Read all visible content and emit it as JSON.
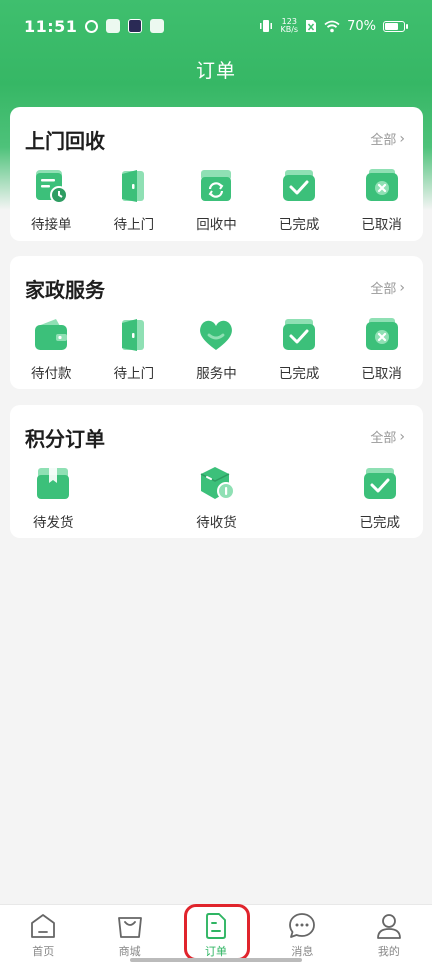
{
  "status_bar": {
    "time": "11:51",
    "net_speed_top": "123",
    "net_speed_bottom": "KB/s",
    "battery": "70%"
  },
  "header": {
    "title": "订单"
  },
  "sections": [
    {
      "title": "上门回收",
      "all_label": "全部",
      "items": [
        {
          "label": "待接单",
          "icon": "pending-order-icon"
        },
        {
          "label": "待上门",
          "icon": "door-icon"
        },
        {
          "label": "回收中",
          "icon": "recycle-box-icon"
        },
        {
          "label": "已完成",
          "icon": "check-icon"
        },
        {
          "label": "已取消",
          "icon": "cancel-icon"
        }
      ]
    },
    {
      "title": "家政服务",
      "all_label": "全部",
      "items": [
        {
          "label": "待付款",
          "icon": "wallet-icon"
        },
        {
          "label": "待上门",
          "icon": "door-icon"
        },
        {
          "label": "服务中",
          "icon": "heart-icon"
        },
        {
          "label": "已完成",
          "icon": "check-icon"
        },
        {
          "label": "已取消",
          "icon": "cancel-icon"
        }
      ]
    },
    {
      "title": "积分订单",
      "all_label": "全部",
      "items": [
        {
          "label": "待发货",
          "icon": "package-icon"
        },
        {
          "label": "待收货",
          "icon": "delivery-box-icon"
        },
        {
          "label": "已完成",
          "icon": "check-icon"
        }
      ]
    }
  ],
  "tabbar": [
    {
      "label": "首页",
      "icon": "home-icon"
    },
    {
      "label": "商城",
      "icon": "shop-bag-icon"
    },
    {
      "label": "订单",
      "icon": "order-doc-icon",
      "active": true
    },
    {
      "label": "消息",
      "icon": "message-icon"
    },
    {
      "label": "我的",
      "icon": "user-icon"
    }
  ],
  "colors": {
    "brand_green": "#3fbf6e",
    "icon_green": "#3cc07a",
    "icon_green_light": "#8fe0b4",
    "active_tab": "#2fb563",
    "highlight_red": "#e0242c"
  }
}
